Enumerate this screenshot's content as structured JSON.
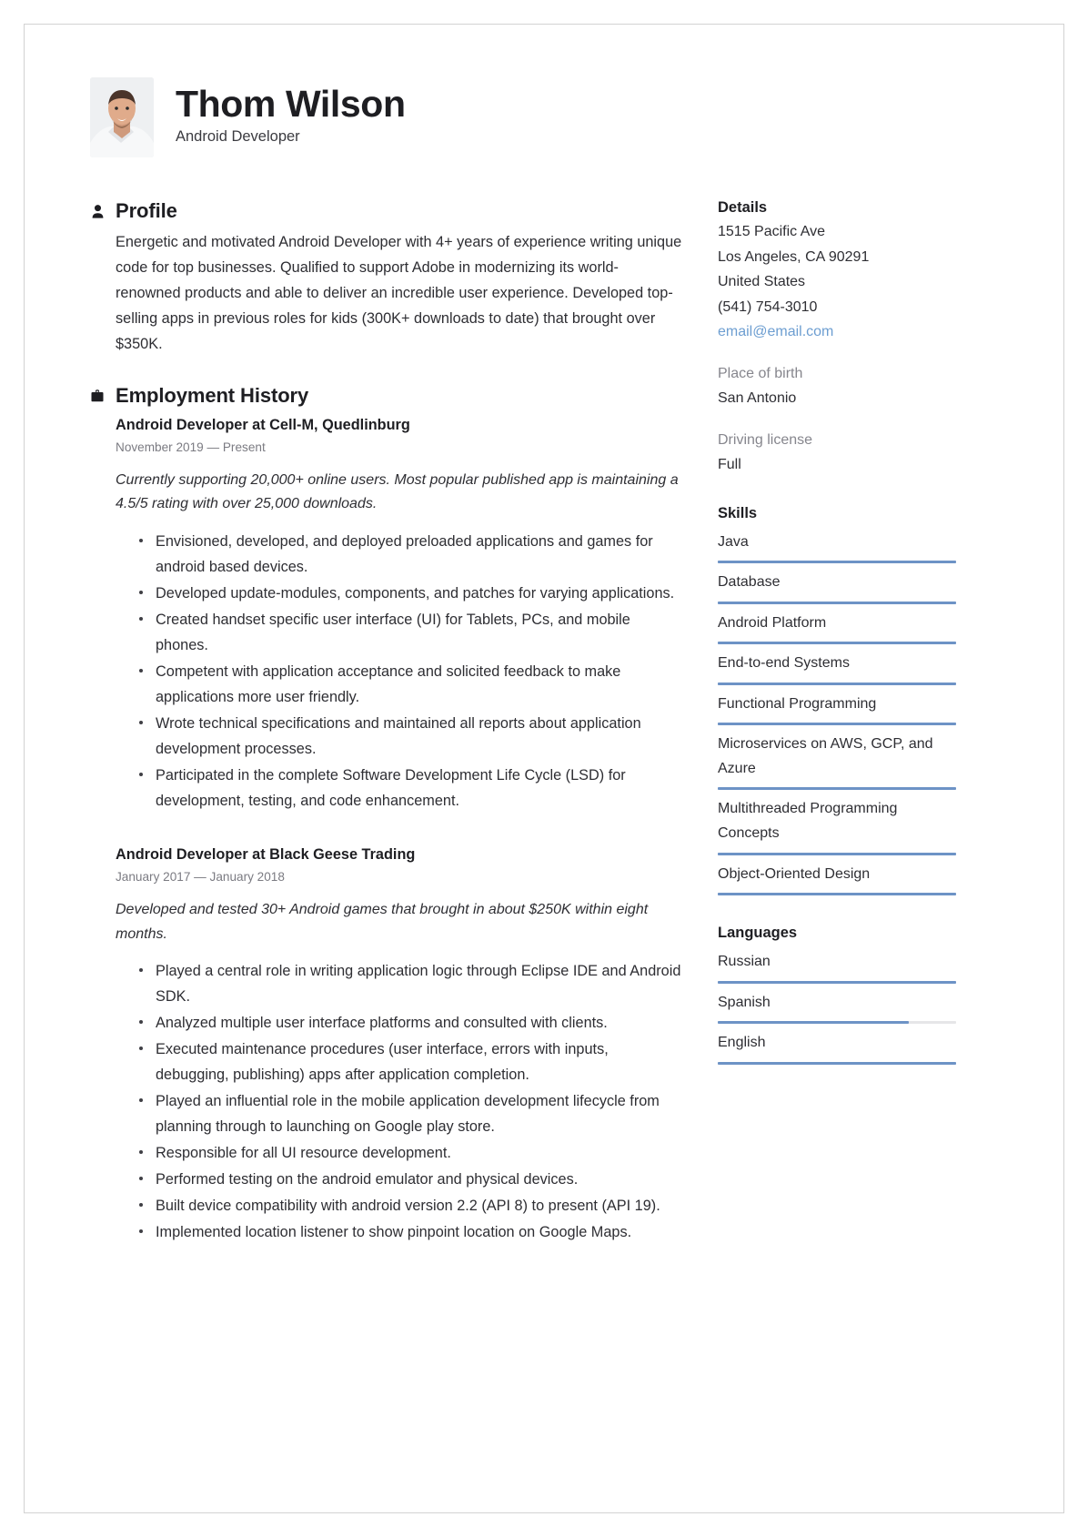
{
  "header": {
    "name": "Thom Wilson",
    "job_title": "Android Developer",
    "avatar_alt": "profile-photo"
  },
  "profile": {
    "heading": "Profile",
    "icon": "person-icon",
    "text": "Energetic and motivated Android Developer with 4+ years of experience writing unique code for top businesses. Qualified to support Adobe in modernizing its world-renowned products and able to deliver an incredible user experience. Developed top-selling apps in previous roles for kids (300K+ downloads to date) that brought over $350K."
  },
  "employment": {
    "heading": "Employment History",
    "icon": "briefcase-icon",
    "jobs": [
      {
        "title": "Android Developer at Cell-M, Quedlinburg",
        "dates": "November 2019 — Present",
        "summary": "Currently supporting 20,000+ online users. Most popular published app is maintaining a 4.5/5 rating with over 25,000 downloads.",
        "bullets": [
          "Envisioned, developed, and deployed preloaded applications and games for android based devices.",
          "Developed update-modules, components, and patches for varying applications.",
          "Created handset specific user interface (UI) for Tablets, PCs, and mobile phones.",
          "Competent with application acceptance and solicited feedback to make applications more user friendly.",
          "Wrote technical specifications and maintained all reports about application development processes.",
          "Participated in the complete Software Development Life Cycle (LSD) for development, testing, and code enhancement."
        ]
      },
      {
        "title": "Android Developer at Black Geese Trading",
        "dates": "January 2017 — January 2018",
        "summary": "Developed and tested 30+ Android games that brought in about $250K within eight months.",
        "bullets": [
          "Played a central role in writing application logic through Eclipse IDE and Android SDK.",
          "Analyzed multiple user interface platforms and consulted with clients.",
          "Executed maintenance procedures (user interface, errors with inputs, debugging, publishing) apps after application completion.",
          "Played an influential role in the mobile application development lifecycle from planning through to launching on Google play store.",
          "Responsible for all UI resource development.",
          "Performed testing on the android emulator and physical devices.",
          "Built device compatibility with android version 2.2 (API 8) to present (API 19).",
          "Implemented location listener to show pinpoint location on Google Maps."
        ]
      }
    ]
  },
  "details": {
    "heading": "Details",
    "address_line1": "1515 Pacific Ave",
    "address_line2": "Los Angeles, CA 90291",
    "country": "United States",
    "phone": "(541) 754-3010",
    "email": "email@email.com",
    "place_of_birth_label": "Place of birth",
    "place_of_birth": "San Antonio",
    "driving_license_label": "Driving license",
    "driving_license": "Full"
  },
  "skills": {
    "heading": "Skills",
    "items": [
      {
        "label": "Java",
        "level": 100
      },
      {
        "label": "Database",
        "level": 100
      },
      {
        "label": "Android Platform",
        "level": 100
      },
      {
        "label": "End-to-end Systems",
        "level": 100
      },
      {
        "label": "Functional Programming",
        "level": 100
      },
      {
        "label": "Microservices on AWS, GCP, and Azure",
        "level": 100
      },
      {
        "label": "Multithreaded Programming Concepts",
        "level": 100
      },
      {
        "label": "Object-Oriented Design",
        "level": 100
      }
    ]
  },
  "languages": {
    "heading": "Languages",
    "items": [
      {
        "label": "Russian",
        "level": 100
      },
      {
        "label": "Spanish",
        "level": 80
      },
      {
        "label": "English",
        "level": 100
      }
    ]
  },
  "colors": {
    "accent": "#6d93c6",
    "link": "#6d9ed1",
    "text": "#2e2e33",
    "muted": "#86868d",
    "track": "#e6e6e8"
  }
}
